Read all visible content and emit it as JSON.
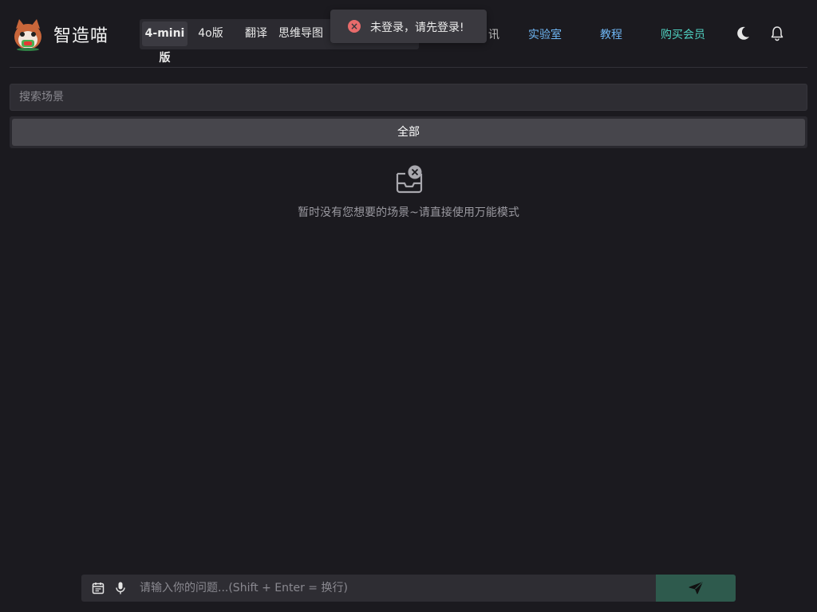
{
  "header": {
    "brand": "智造喵",
    "tabs": [
      {
        "label": "4-mini版",
        "active": true
      },
      {
        "label": "4o版",
        "active": false
      },
      {
        "label": "翻译",
        "active": false
      },
      {
        "label": "思维导图",
        "active": false
      }
    ],
    "partial_tab_glyph": "讯",
    "nav_links": [
      {
        "label": "实验室",
        "color": "#6fb7f5"
      },
      {
        "label": "教程",
        "color": "#6fb7f5"
      },
      {
        "label": "购买会员",
        "color": "#4fd0c0"
      }
    ],
    "icons": [
      "theme-moon-icon",
      "notification-bell-icon"
    ]
  },
  "toast": {
    "type": "error",
    "icon": "error-circle-icon",
    "message": "未登录，请先登录!"
  },
  "search": {
    "placeholder": "搜索场景",
    "value": ""
  },
  "category": {
    "all_label": "全部"
  },
  "empty_state": {
    "icon": "empty-inbox-icon",
    "message": "暂时没有您想要的场景~请直接使用万能模式"
  },
  "composer": {
    "placeholder": "请输入你的问题...(Shift + Enter = 换行)",
    "value": "",
    "icons": [
      "calendar-icon",
      "microphone-icon",
      "send-icon"
    ]
  },
  "colors": {
    "background": "#1b1a1f",
    "accent_link": "#6fb7f5",
    "accent_member": "#4fd0c0",
    "send_button": "#2e5a4d",
    "error": "#e86b6b"
  }
}
